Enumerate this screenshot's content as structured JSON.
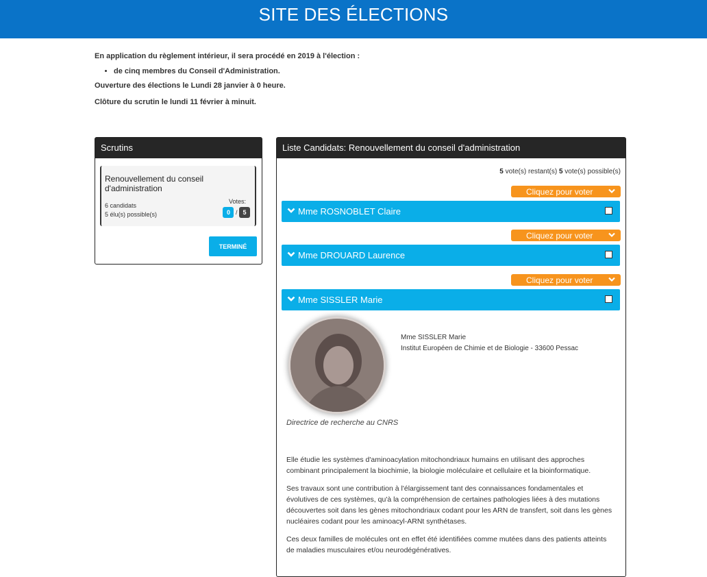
{
  "header": {
    "title": "SITE DES ÉLECTIONS"
  },
  "intro": {
    "line1": "En application du règlement intérieur, il sera procédé en 2019 à l'élection :",
    "bullet": "de cinq membres du Conseil d'Administration.",
    "ouverture": "Ouverture des élections le Lundi 28 janvier à 0 heure.",
    "cloture": "Clôture du scrutin le lundi 11 février à minuit."
  },
  "scrutins": {
    "title": "Scrutins",
    "card": {
      "title": "Renouvellement du conseil d'administration",
      "candidats": "6 candidats",
      "elus": "5 élu(s) possible(s)",
      "votes_label": "Votes:",
      "votes_cast": "0",
      "separator": "/",
      "votes_total": "5"
    },
    "termine_label": "TERMINÉ"
  },
  "candidats": {
    "title": "Liste Candidats: Renouvellement du conseil d'administration",
    "votes_restants_num": "5",
    "votes_restants_text": " vote(s) restant(s) ",
    "votes_possibles_num": "5",
    "votes_possibles_text": " vote(s) possible(s)",
    "vote_button_label": "Cliquez pour voter",
    "list": [
      {
        "name": "Mme ROSNOBLET Claire"
      },
      {
        "name": "Mme DROUARD Laurence"
      },
      {
        "name": "Mme SISSLER Marie"
      }
    ],
    "detail": {
      "name": "Mme SISSLER Marie",
      "institution": "Institut Européen de Chimie et de Biologie - 33600 Pessac",
      "role": "Directrice de recherche au CNRS",
      "bio": [
        "Elle étudie les systèmes d'aminoacylation mitochondriaux humains en utilisant des approches combinant principalement la biochimie, la biologie moléculaire et cellulaire et la bioinformatique.",
        "Ses travaux sont une contribution à l'élargissement tant des connaissances fondamentales et évolutives de ces systèmes, qu'à la compréhension de certaines pathologies liées à des mutations découvertes soit dans les gènes mitochondriaux codant pour les ARN de transfert, soit dans les gènes nucléaires codant pour les aminoacyl-ARNt synthétases.",
        "Ces deux familles de molécules ont en effet été identifiées comme mutées dans des patients atteints de maladies musculaires et/ou neurodégénératives."
      ]
    }
  },
  "colors": {
    "header": "#0a73c8",
    "accent_blue": "#0aaee8",
    "vote_orange": "#f7941d",
    "panel_dark": "#262626"
  }
}
